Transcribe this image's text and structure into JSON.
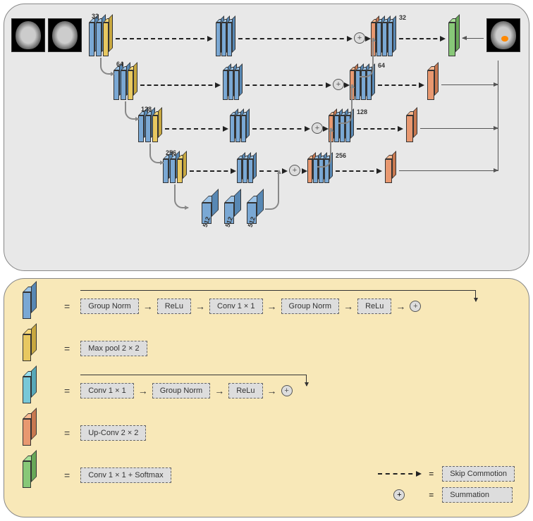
{
  "architecture": {
    "channels": {
      "level1": "32",
      "level2": "64",
      "level3": "128",
      "level4": "256",
      "level5": "512",
      "dec1": "32",
      "dec2": "64",
      "dec3": "128",
      "dec4": "256"
    }
  },
  "legend": {
    "blue_block": {
      "ops": [
        "Group Norm",
        "ReLu",
        "Conv 1 × 1",
        "Group Norm",
        "ReLu"
      ]
    },
    "yellow_block": {
      "op": "Max pool 2 × 2"
    },
    "cyan_block": {
      "ops": [
        "Conv 1 × 1",
        "Group Norm",
        "ReLu"
      ]
    },
    "orange_block": {
      "op": "Up-Conv 2 × 2"
    },
    "green_block": {
      "op": "Conv 1 × 1 + Softmax"
    },
    "symbols": {
      "skip": "Skip Commotion",
      "sum": "Summation",
      "eq": "="
    }
  }
}
